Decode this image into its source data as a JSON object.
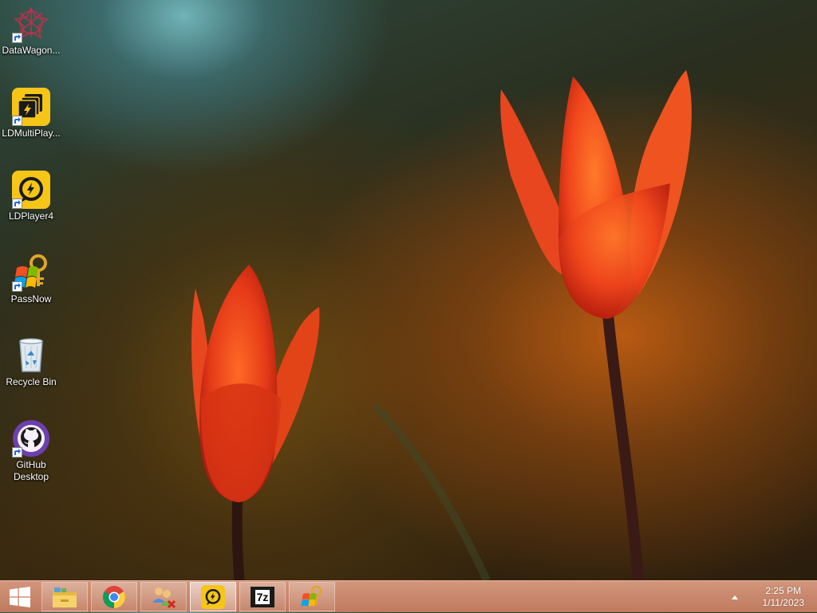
{
  "desktop": {
    "icons": [
      {
        "label": "DataWagon...",
        "icon": "datawagon-icon"
      },
      {
        "label": "LDMultiPlay...",
        "icon": "ldmultiplayer-icon"
      },
      {
        "label": "LDPlayer4",
        "icon": "ldplayer-icon"
      },
      {
        "label": "PassNow",
        "icon": "passnow-icon"
      },
      {
        "label": "Recycle Bin",
        "icon": "recycle-bin-icon"
      },
      {
        "label": "GitHub Desktop",
        "icon": "github-desktop-icon"
      }
    ]
  },
  "taskbar": {
    "start": {
      "icon": "windows-logo-icon"
    },
    "pinned": [
      {
        "icon": "file-explorer-icon"
      },
      {
        "icon": "chrome-icon"
      },
      {
        "icon": "network-users-icon"
      },
      {
        "icon": "ldplayer-icon"
      },
      {
        "icon": "7zip-icon",
        "text": "7z"
      },
      {
        "icon": "passnow-icon"
      }
    ],
    "clock": {
      "time": "2:25 PM",
      "date": "1/11/2023"
    }
  },
  "colors": {
    "taskbar": "#c9886c",
    "ld_yellow": "#f5c518",
    "github_purple": "#6e3fb0",
    "tulip_red": "#e8401a"
  }
}
